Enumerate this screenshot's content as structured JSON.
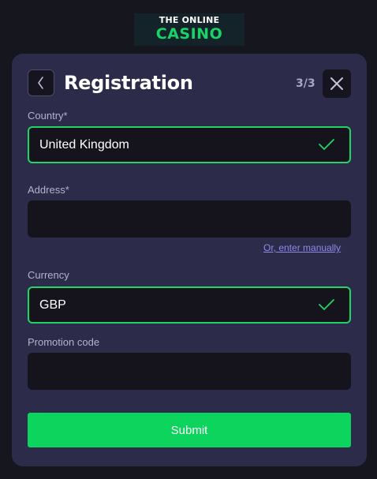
{
  "logo": {
    "line1": "THE ONLINE",
    "line2": "CASINO"
  },
  "header": {
    "title": "Registration",
    "step": "3/3",
    "back_icon": "chevron-left-icon",
    "close_icon": "close-icon"
  },
  "form": {
    "country": {
      "label": "Country*",
      "value": "United Kingdom",
      "status_icon": "checkmark-icon"
    },
    "address": {
      "label": "Address*",
      "value": "",
      "manual_link": "Or, enter manually"
    },
    "currency": {
      "label": "Currency",
      "value": "GBP",
      "status_icon": "checkmark-icon"
    },
    "promotion": {
      "label": "Promotion code",
      "value": ""
    },
    "submit_label": "Submit"
  },
  "colors": {
    "page_background": "#16161f",
    "card_background": "#2c2b4a",
    "field_background": "#15141d",
    "accent_green": "#0dd45c",
    "valid_border": "#1ed565",
    "link": "#8b8bea"
  }
}
